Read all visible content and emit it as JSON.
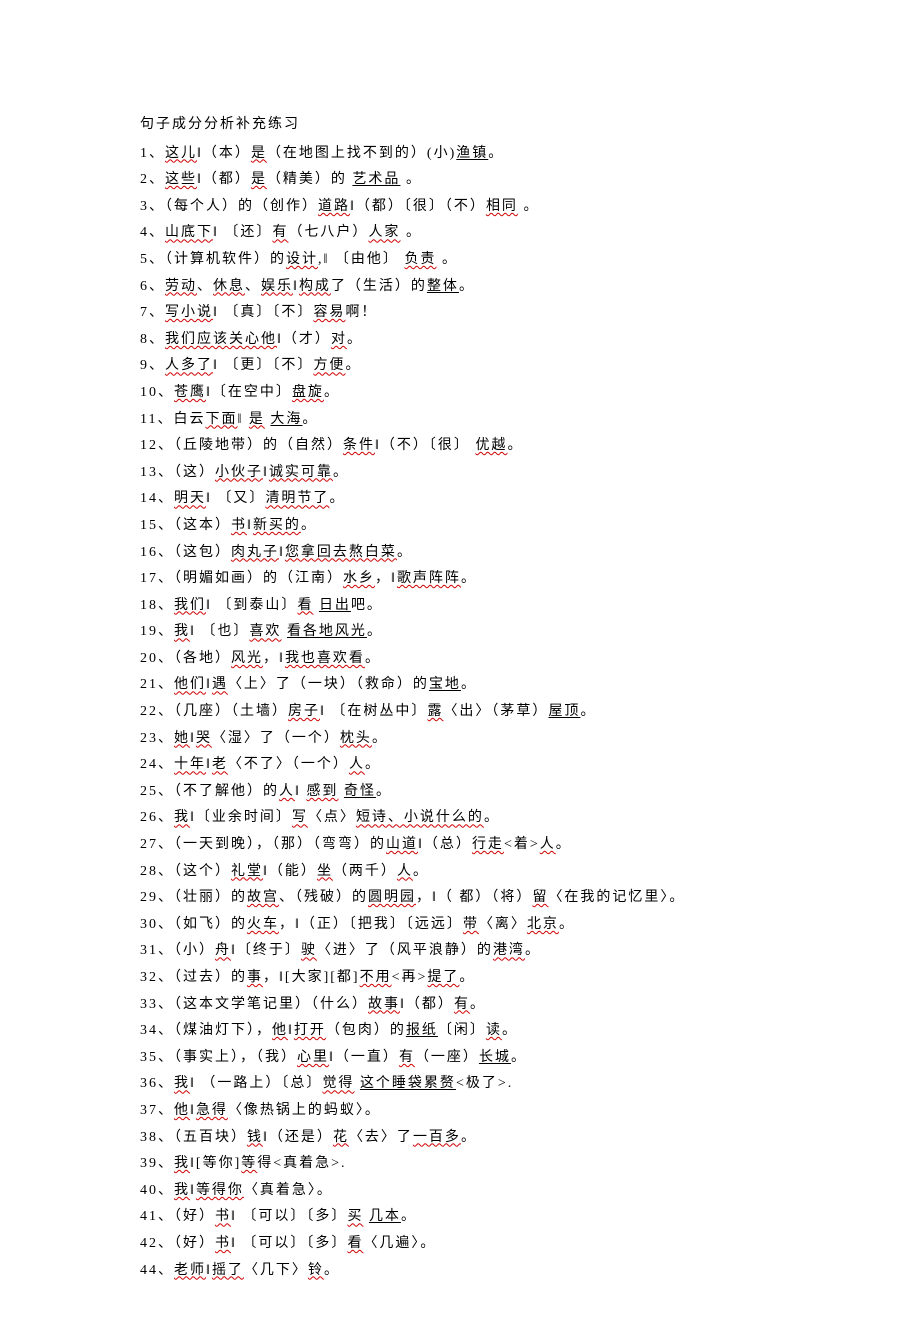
{
  "title": "句子成分分析补充练习",
  "lines": [
    {
      "n": "1、",
      "segs": [
        [
          "这儿",
          "wavy"
        ],
        [
          "‖（本）",
          "p"
        ],
        [
          "是",
          "wavy"
        ],
        [
          "（在地图上找不到的）(小)",
          "p"
        ],
        [
          "渔镇",
          "ul"
        ],
        [
          "。",
          "p"
        ]
      ]
    },
    {
      "n": "2、",
      "segs": [
        [
          "这些",
          "wavy"
        ],
        [
          "‖（都）",
          "p"
        ],
        [
          "是",
          "wavy"
        ],
        [
          "（精美）的 ",
          "p"
        ],
        [
          "艺术品",
          "ul"
        ],
        [
          " 。",
          "p"
        ]
      ]
    },
    {
      "n": "3、",
      "segs": [
        [
          "（每个人）的（创作）",
          "p"
        ],
        [
          "道路",
          "wavy"
        ],
        [
          "‖（都）〔很〕（不）",
          "p"
        ],
        [
          "相同",
          "wavy"
        ],
        [
          " 。",
          "p"
        ]
      ]
    },
    {
      "n": "4、",
      "segs": [
        [
          "山底下",
          "wavy"
        ],
        [
          "‖ 〔还〕",
          "p"
        ],
        [
          "有",
          "wavy"
        ],
        [
          "（七八户）",
          "p"
        ],
        [
          "人家",
          "wavy"
        ],
        [
          "  。",
          "p"
        ]
      ]
    },
    {
      "n": "5、",
      "segs": [
        [
          "（计算机软件）的",
          "p"
        ],
        [
          "设计",
          "wavy"
        ],
        [
          ",‖ 〔由他〕 ",
          "p"
        ],
        [
          "负责",
          "wavy"
        ],
        [
          " 。",
          "p"
        ]
      ]
    },
    {
      "n": "6、",
      "segs": [
        [
          "劳动",
          "wavy"
        ],
        [
          "、",
          "p"
        ],
        [
          "休息",
          "wavy"
        ],
        [
          "、",
          "p"
        ],
        [
          "娱乐",
          "wavy"
        ],
        [
          "‖",
          "p"
        ],
        [
          "构成",
          "wavy"
        ],
        [
          "了（生活）的",
          "p"
        ],
        [
          "整体",
          "ul"
        ],
        [
          "。",
          "p"
        ]
      ]
    },
    {
      "n": "7、",
      "segs": [
        [
          "写小说",
          "wavy"
        ],
        [
          "‖ 〔真〕〔不〕",
          "p"
        ],
        [
          "容易",
          "wavy"
        ],
        [
          "啊！",
          "p"
        ]
      ]
    },
    {
      "n": "8、",
      "segs": [
        [
          "我们应该关心他",
          "wavy"
        ],
        [
          "‖（才）",
          "p"
        ],
        [
          "对",
          "wavy"
        ],
        [
          "。",
          "p"
        ]
      ]
    },
    {
      "n": "9、",
      "segs": [
        [
          "人多了",
          "wavy"
        ],
        [
          "‖ 〔更〕〔不〕",
          "p"
        ],
        [
          "方便",
          "wavy"
        ],
        [
          "。",
          "p"
        ]
      ]
    },
    {
      "n": "10、",
      "segs": [
        [
          "苍鹰",
          "wavy"
        ],
        [
          "‖〔在空中〕",
          "p"
        ],
        [
          "盘旋",
          "wavy"
        ],
        [
          "。",
          "p"
        ]
      ]
    },
    {
      "n": "11、",
      "segs": [
        [
          "白云",
          "p"
        ],
        [
          "下面",
          "wavy"
        ],
        [
          "‖ ",
          "p"
        ],
        [
          "是",
          "wavy"
        ],
        [
          " ",
          "p"
        ],
        [
          "大海",
          "ul"
        ],
        [
          "。",
          "p"
        ]
      ]
    },
    {
      "n": "12、",
      "segs": [
        [
          "（丘陵地带）的（自然）",
          "p"
        ],
        [
          "条件",
          "wavy"
        ],
        [
          "‖（不）〔很〕 ",
          "p"
        ],
        [
          "优越",
          "wavy"
        ],
        [
          "。",
          "p"
        ]
      ]
    },
    {
      "n": "13、",
      "segs": [
        [
          "（这）",
          "p"
        ],
        [
          "小伙子",
          "wavy"
        ],
        [
          "‖",
          "p"
        ],
        [
          "诚实可靠",
          "wavy"
        ],
        [
          "。",
          "p"
        ]
      ]
    },
    {
      "n": "14、",
      "segs": [
        [
          "明天",
          "wavy"
        ],
        [
          "‖ 〔又〕",
          "p"
        ],
        [
          "清明节了",
          "wavy"
        ],
        [
          "。",
          "p"
        ]
      ]
    },
    {
      "n": "15、",
      "segs": [
        [
          "（这本）",
          "p"
        ],
        [
          "书",
          "wavy"
        ],
        [
          "‖",
          "p"
        ],
        [
          "新买的",
          "wavy"
        ],
        [
          "。",
          "p"
        ]
      ]
    },
    {
      "n": "16、",
      "segs": [
        [
          "（这包）",
          "p"
        ],
        [
          "肉丸子",
          "wavy"
        ],
        [
          "‖",
          "p"
        ],
        [
          "您拿回去熬白菜",
          "wavy"
        ],
        [
          "。",
          "p"
        ]
      ]
    },
    {
      "n": "17、",
      "segs": [
        [
          "（明媚如画）的（江南）",
          "p"
        ],
        [
          "水乡",
          "wavy"
        ],
        [
          "，‖",
          "p"
        ],
        [
          "歌声阵阵",
          "wavy"
        ],
        [
          "。",
          "p"
        ]
      ]
    },
    {
      "n": "18、",
      "segs": [
        [
          "我们",
          "wavy"
        ],
        [
          "‖ 〔到泰山〕",
          "p"
        ],
        [
          "看",
          "wavy"
        ],
        [
          " ",
          "p"
        ],
        [
          "日出",
          "ul"
        ],
        [
          "吧。",
          "p"
        ]
      ]
    },
    {
      "n": "19、",
      "segs": [
        [
          "我",
          "wavy"
        ],
        [
          "‖ 〔也〕",
          "p"
        ],
        [
          "喜欢",
          "wavy"
        ],
        [
          " ",
          "p"
        ],
        [
          "看各地风光",
          "ul"
        ],
        [
          "。",
          "p"
        ]
      ]
    },
    {
      "n": "20、",
      "segs": [
        [
          "（各地）",
          "p"
        ],
        [
          "风光",
          "wavy"
        ],
        [
          "，‖",
          "p"
        ],
        [
          "我也喜欢看",
          "wavy"
        ],
        [
          "。",
          "p"
        ]
      ]
    },
    {
      "n": "21、",
      "segs": [
        [
          "他们",
          "wavy"
        ],
        [
          "‖",
          "p"
        ],
        [
          "遇",
          "wavy"
        ],
        [
          "〈上〉了（一块）（救命）的",
          "p"
        ],
        [
          "宝地",
          "ul"
        ],
        [
          "。",
          "p"
        ]
      ]
    },
    {
      "n": "22、",
      "segs": [
        [
          "（几座）（土墙）",
          "p"
        ],
        [
          "房子",
          "wavy"
        ],
        [
          "‖ 〔在树丛中〕",
          "p"
        ],
        [
          "露",
          "wavy"
        ],
        [
          "〈出〉（茅草）",
          "p"
        ],
        [
          "屋顶",
          "ul"
        ],
        [
          "。",
          "p"
        ]
      ]
    },
    {
      "n": "23、",
      "segs": [
        [
          "她",
          "wavy"
        ],
        [
          "‖",
          "p"
        ],
        [
          "哭",
          "wavy"
        ],
        [
          "〈湿〉了（一个）",
          "p"
        ],
        [
          "枕头",
          "wavy"
        ],
        [
          "。",
          "p"
        ]
      ]
    },
    {
      "n": "24、",
      "segs": [
        [
          "十年",
          "wavy"
        ],
        [
          "‖",
          "p"
        ],
        [
          "老",
          "wavy"
        ],
        [
          "〈不了〉（一个）",
          "p"
        ],
        [
          "人",
          "wavy"
        ],
        [
          "。",
          "p"
        ]
      ]
    },
    {
      "n": "25、",
      "segs": [
        [
          "（不了解他）的",
          "p"
        ],
        [
          "人",
          "wavy"
        ],
        [
          "‖  ",
          "p"
        ],
        [
          "感到",
          "wavy"
        ],
        [
          " ",
          "p"
        ],
        [
          "奇怪",
          "ul"
        ],
        [
          "。",
          "p"
        ]
      ]
    },
    {
      "n": "26、",
      "segs": [
        [
          "我",
          "wavy"
        ],
        [
          "‖〔业余时间〕",
          "p"
        ],
        [
          "写",
          "wavy"
        ],
        [
          "〈点〉",
          "p"
        ],
        [
          "短诗、小说什么的",
          "wavy"
        ],
        [
          "。",
          "p"
        ]
      ]
    },
    {
      "n": "27、",
      "segs": [
        [
          "（一天到晚），（那）（弯弯）的",
          "p"
        ],
        [
          "山道",
          "wavy"
        ],
        [
          "‖（总）",
          "p"
        ],
        [
          "行走",
          "wavy"
        ],
        [
          "<着>",
          "p"
        ],
        [
          "人",
          "wavy"
        ],
        [
          "。",
          "p"
        ]
      ]
    },
    {
      "n": "28、",
      "segs": [
        [
          "（这个）",
          "p"
        ],
        [
          "礼堂",
          "wavy"
        ],
        [
          "‖（能）",
          "p"
        ],
        [
          "坐",
          "wavy"
        ],
        [
          "（两千）",
          "p"
        ],
        [
          "人",
          "wavy"
        ],
        [
          "。",
          "p"
        ]
      ]
    },
    {
      "n": "29、",
      "segs": [
        [
          "（壮丽）的",
          "p"
        ],
        [
          "故宫",
          "wavy"
        ],
        [
          "、（残破）的",
          "p"
        ],
        [
          "圆明园",
          "wavy"
        ],
        [
          "，‖（ 都）（将）",
          "p"
        ],
        [
          "留",
          "wavy"
        ],
        [
          "〈在我的记忆里〉。",
          "p"
        ]
      ]
    },
    {
      "n": "30、",
      "segs": [
        [
          "（如飞）的",
          "p"
        ],
        [
          "火车",
          "wavy"
        ],
        [
          "，‖（正）〔把我〕〔远远〕",
          "p"
        ],
        [
          "带",
          "wavy"
        ],
        [
          "〈离〉",
          "p"
        ],
        [
          "北京",
          "wavy"
        ],
        [
          "。",
          "p"
        ]
      ]
    },
    {
      "n": "31、",
      "segs": [
        [
          "（小）",
          "p"
        ],
        [
          "舟",
          "wavy"
        ],
        [
          "‖〔终于〕",
          "p"
        ],
        [
          "驶",
          "wavy"
        ],
        [
          "〈进〉了（风平浪静）的",
          "p"
        ],
        [
          "港湾",
          "wavy"
        ],
        [
          "。",
          "p"
        ]
      ]
    },
    {
      "n": "32、",
      "segs": [
        [
          "（过去）的",
          "p"
        ],
        [
          "事",
          "wavy"
        ],
        [
          "，‖[大家][都]",
          "p"
        ],
        [
          "不用",
          "wavy"
        ],
        [
          "<再>",
          "p"
        ],
        [
          "提了",
          "wavy"
        ],
        [
          "。",
          "p"
        ]
      ]
    },
    {
      "n": "33、",
      "segs": [
        [
          "（这本文学笔记里）（什么）",
          "p"
        ],
        [
          "故事",
          "wavy"
        ],
        [
          "‖（都）",
          "p"
        ],
        [
          "有",
          "wavy"
        ],
        [
          "。",
          "p"
        ]
      ]
    },
    {
      "n": "34、",
      "segs": [
        [
          "（煤油灯下），",
          "p"
        ],
        [
          "他",
          "wavy"
        ],
        [
          "‖",
          "p"
        ],
        [
          "打开",
          "wavy"
        ],
        [
          "（包肉）的",
          "p"
        ],
        [
          "报纸",
          "ul"
        ],
        [
          "〔闲〕",
          "p"
        ],
        [
          "读",
          "wavy"
        ],
        [
          "。",
          "p"
        ]
      ]
    },
    {
      "n": "35、",
      "segs": [
        [
          "（事实上），（我）",
          "p"
        ],
        [
          "心里",
          "wavy"
        ],
        [
          "‖（一直）",
          "p"
        ],
        [
          "有",
          "wavy"
        ],
        [
          "（一座）",
          "p"
        ],
        [
          "长城",
          "ul"
        ],
        [
          "。",
          "p"
        ]
      ]
    },
    {
      "n": "36、",
      "segs": [
        [
          "我",
          "wavy"
        ],
        [
          "‖ （一路上）〔总〕",
          "p"
        ],
        [
          "觉得",
          "wavy"
        ],
        [
          "  ",
          "p"
        ],
        [
          "这个睡袋累赘",
          "ul"
        ],
        [
          "<极了>.",
          "p"
        ]
      ]
    },
    {
      "n": "37、",
      "segs": [
        [
          "他",
          "wavy"
        ],
        [
          "‖",
          "p"
        ],
        [
          "急得",
          "wavy"
        ],
        [
          "〈像热锅上的蚂蚁〉。",
          "p"
        ]
      ]
    },
    {
      "n": "38、",
      "segs": [
        [
          "（五百块）",
          "p"
        ],
        [
          "钱",
          "wavy"
        ],
        [
          "‖（还是）",
          "p"
        ],
        [
          "花",
          "wavy"
        ],
        [
          "〈去〉了",
          "p"
        ],
        [
          "一百多",
          "wavy"
        ],
        [
          "。",
          "p"
        ]
      ]
    },
    {
      "n": "39、",
      "segs": [
        [
          "我",
          "wavy"
        ],
        [
          "‖[等你]",
          "p"
        ],
        [
          "等",
          "wavy"
        ],
        [
          "得<真着急>.",
          "p"
        ]
      ]
    },
    {
      "n": "40、",
      "segs": [
        [
          "我",
          "wavy"
        ],
        [
          "‖",
          "p"
        ],
        [
          "等得你",
          "wavy"
        ],
        [
          "〈真着急〉。",
          "p"
        ]
      ]
    },
    {
      "n": "41、",
      "segs": [
        [
          "（好）",
          "p"
        ],
        [
          "书",
          "wavy"
        ],
        [
          "‖ 〔可以〕〔多〕",
          "p"
        ],
        [
          "买",
          "wavy"
        ],
        [
          " ",
          "p"
        ],
        [
          "几本",
          "ul"
        ],
        [
          "。",
          "p"
        ]
      ]
    },
    {
      "n": "42、",
      "segs": [
        [
          "（好）",
          "p"
        ],
        [
          "书",
          "wavy"
        ],
        [
          "‖ 〔可以〕〔多〕",
          "p"
        ],
        [
          "看",
          "wavy"
        ],
        [
          "〈几遍〉。",
          "p"
        ]
      ]
    },
    {
      "n": "44、",
      "segs": [
        [
          "老师",
          "wavy"
        ],
        [
          "‖",
          "p"
        ],
        [
          "摇了",
          "wavy"
        ],
        [
          "〈几下〉",
          "p"
        ],
        [
          "铃",
          "wavy"
        ],
        [
          "。",
          "p"
        ]
      ]
    }
  ]
}
